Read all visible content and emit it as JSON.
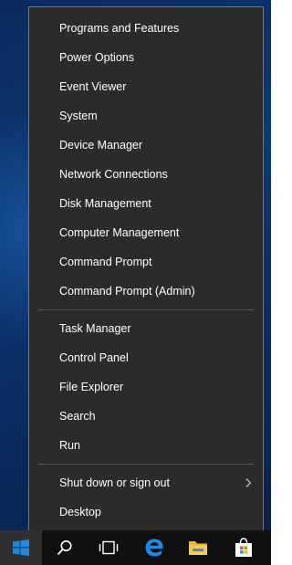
{
  "menu": {
    "items": [
      {
        "label": "Programs and Features"
      },
      {
        "label": "Power Options"
      },
      {
        "label": "Event Viewer"
      },
      {
        "label": "System"
      },
      {
        "label": "Device Manager"
      },
      {
        "label": "Network Connections"
      },
      {
        "label": "Disk Management"
      },
      {
        "label": "Computer Management"
      },
      {
        "label": "Command Prompt"
      },
      {
        "label": "Command Prompt (Admin)"
      },
      {
        "label": "Task Manager"
      },
      {
        "label": "Control Panel"
      },
      {
        "label": "File Explorer"
      },
      {
        "label": "Search"
      },
      {
        "label": "Run"
      },
      {
        "label": "Shut down or sign out",
        "has_submenu": true
      },
      {
        "label": "Desktop"
      }
    ]
  },
  "taskbar": {
    "buttons": [
      {
        "icon": "windows-start-icon"
      },
      {
        "icon": "search-icon"
      },
      {
        "icon": "task-view-icon"
      },
      {
        "icon": "edge-browser-icon"
      },
      {
        "icon": "file-explorer-icon"
      },
      {
        "icon": "store-icon"
      }
    ]
  },
  "colors": {
    "menu_bg": "#2b2b2b",
    "menu_border": "#777777",
    "text": "#ffffff",
    "taskbar_bg": "#101010",
    "accent": "#1e88e5"
  }
}
